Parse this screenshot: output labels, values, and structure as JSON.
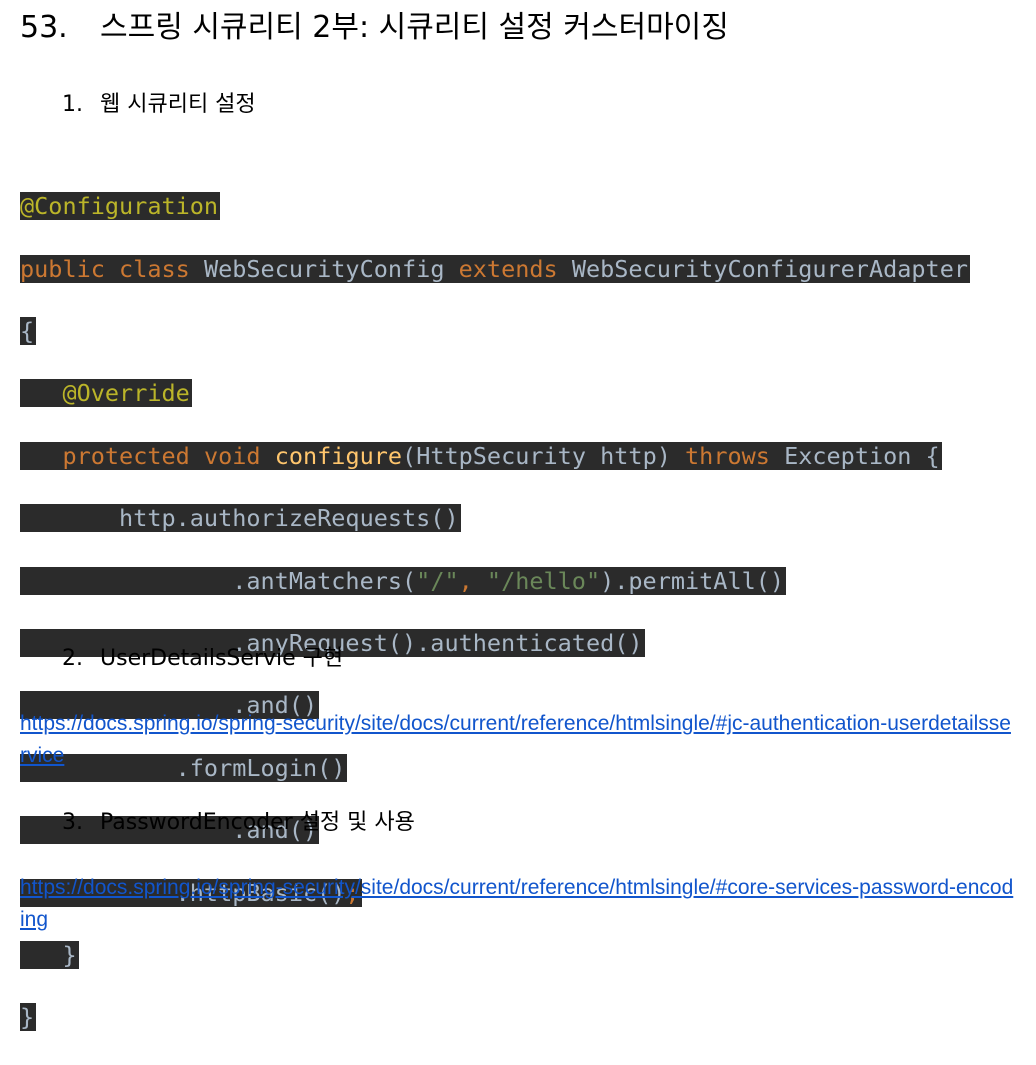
{
  "heading": {
    "number": "53.",
    "title": "스프링 시큐리티 2부: 시큐리티 설정 커스터마이징"
  },
  "items": [
    {
      "num": "1.",
      "text": "웹 시큐리티 설정"
    },
    {
      "num": "2.",
      "text": "UserDetailsServie 구현"
    },
    {
      "num": "3.",
      "text": "PasswordEncoder 설정 및 사용"
    }
  ],
  "code": {
    "annotation_config": "@Configuration",
    "kw_public": "public",
    "kw_class": "class",
    "class_name": "WebSecurityConfig",
    "kw_extends": "extends",
    "parent_class": "WebSecurityConfigurerAdapter",
    "open_brace": "{",
    "annotation_override": "@Override",
    "kw_protected": "protected",
    "kw_void": "void",
    "method_name": "configure",
    "params": "(HttpSecurity http)",
    "kw_throws": "throws",
    "exception": "Exception {",
    "l6": "http.authorizeRequests()",
    "l7_a": ".antMatchers(",
    "l7_s1": "\"/\"",
    "l7_comma": ", ",
    "l7_s2": "\"/hello\"",
    "l7_b": ").permitAll()",
    "l8": ".anyRequest().authenticated()",
    "l9": ".and()",
    "l10": ".formLogin()",
    "l11": ".and()",
    "l12": ".httpBasic()",
    "l12_semi": ";",
    "close_inner": "}",
    "close_outer": "}"
  },
  "links": {
    "userdetails": "https://docs.spring.io/spring-security/site/docs/current/reference/htmlsingle/#jc-authentication-userdetailsservice",
    "password": "https://docs.spring.io/spring-security/site/docs/current/reference/htmlsingle/#core-services-password-encoding"
  }
}
